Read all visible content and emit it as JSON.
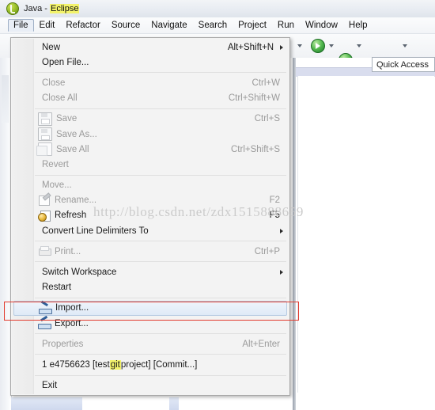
{
  "window": {
    "title_prefix": "Java - ",
    "title_highlight": "Eclipse",
    "app_icon": "eclipse-java-icon"
  },
  "menubar": {
    "items": [
      {
        "label": "File",
        "active": true
      },
      {
        "label": "Edit",
        "active": false
      },
      {
        "label": "Refactor",
        "active": false
      },
      {
        "label": "Source",
        "active": false
      },
      {
        "label": "Navigate",
        "active": false
      },
      {
        "label": "Search",
        "active": false
      },
      {
        "label": "Project",
        "active": false
      },
      {
        "label": "Run",
        "active": false
      },
      {
        "label": "Window",
        "active": false
      },
      {
        "label": "Help",
        "active": false
      }
    ]
  },
  "toolbar": {
    "icons": [
      "run-dropdown-caret",
      "run-icon",
      "run-caret",
      "debug-icon",
      "debug-caret",
      "new-java-project-icon",
      "external-tools-icon",
      "external-tools-caret",
      "open-resource-icon",
      "pen-icon"
    ],
    "quick_access": {
      "label": "Quick Access",
      "name": "quick-access-field"
    }
  },
  "file_menu": {
    "groups": [
      {
        "items": [
          {
            "label": "New",
            "accel": "Alt+Shift+N",
            "submenu": true,
            "disabled": false,
            "icon": null
          },
          {
            "label": "Open File...",
            "accel": "",
            "submenu": false,
            "disabled": false,
            "icon": null
          }
        ]
      },
      {
        "items": [
          {
            "label": "Close",
            "accel": "Ctrl+W",
            "submenu": false,
            "disabled": true,
            "icon": null
          },
          {
            "label": "Close All",
            "accel": "Ctrl+Shift+W",
            "submenu": false,
            "disabled": true,
            "icon": null
          }
        ]
      },
      {
        "items": [
          {
            "label": "Save",
            "accel": "Ctrl+S",
            "submenu": false,
            "disabled": true,
            "icon": "save-icon"
          },
          {
            "label": "Save As...",
            "accel": "",
            "submenu": false,
            "disabled": true,
            "icon": "save-as-icon"
          },
          {
            "label": "Save All",
            "accel": "Ctrl+Shift+S",
            "submenu": false,
            "disabled": true,
            "icon": "save-all-icon"
          },
          {
            "label": "Revert",
            "accel": "",
            "submenu": false,
            "disabled": true,
            "icon": null
          }
        ]
      },
      {
        "items": [
          {
            "label": "Move...",
            "accel": "",
            "submenu": false,
            "disabled": true,
            "icon": null
          },
          {
            "label": "Rename...",
            "accel": "F2",
            "submenu": false,
            "disabled": true,
            "icon": "rename-pencil-icon"
          },
          {
            "label": "Refresh",
            "accel": "F5",
            "submenu": false,
            "disabled": false,
            "icon": "refresh-icon"
          },
          {
            "label": "Convert Line Delimiters To",
            "accel": "",
            "submenu": true,
            "disabled": false,
            "icon": null
          }
        ]
      },
      {
        "items": [
          {
            "label": "Print...",
            "accel": "Ctrl+P",
            "submenu": false,
            "disabled": true,
            "icon": "print-icon"
          }
        ]
      },
      {
        "items": [
          {
            "label": "Switch Workspace",
            "accel": "",
            "submenu": true,
            "disabled": false,
            "icon": null
          },
          {
            "label": "Restart",
            "accel": "",
            "submenu": false,
            "disabled": false,
            "icon": null
          }
        ]
      },
      {
        "items": [
          {
            "label": "Import...",
            "accel": "",
            "submenu": false,
            "disabled": false,
            "icon": "import-icon",
            "hovered": true
          },
          {
            "label": "Export...",
            "accel": "",
            "submenu": false,
            "disabled": false,
            "icon": "export-icon"
          }
        ]
      },
      {
        "items": [
          {
            "label": "Properties",
            "accel": "Alt+Enter",
            "submenu": false,
            "disabled": true,
            "icon": null
          }
        ]
      },
      {
        "items": [
          {
            "label": "1 e4756623 [test",
            "label_highlight": "git",
            "label_tail": "project]  [Commit...]",
            "accel": "",
            "submenu": false,
            "disabled": false,
            "icon": null
          }
        ]
      },
      {
        "items": [
          {
            "label": "Exit",
            "accel": "",
            "submenu": false,
            "disabled": false,
            "icon": null
          }
        ]
      }
    ]
  },
  "annotation": {
    "red_box_target": "Import...",
    "red_box_color": "#e23b2e"
  },
  "watermark": {
    "text": "http://blog.csdn.net/zdx1515888659"
  }
}
